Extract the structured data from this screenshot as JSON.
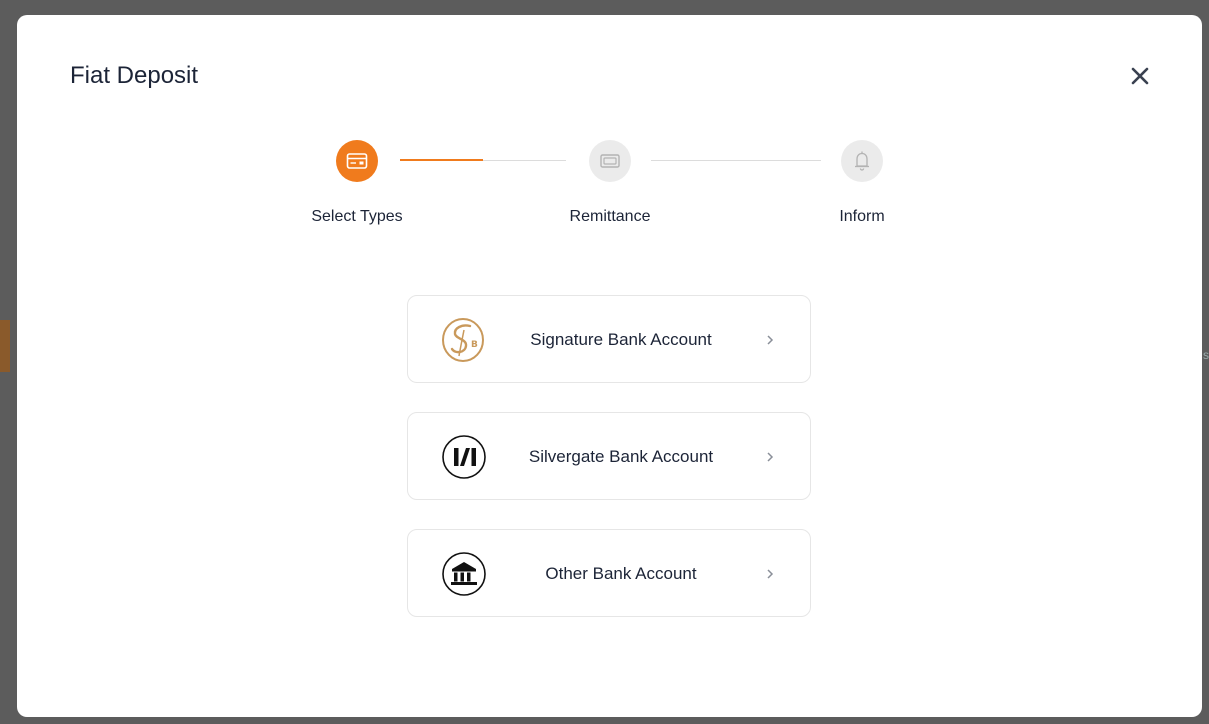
{
  "modal": {
    "title": "Fiat Deposit"
  },
  "stepper": {
    "steps": [
      {
        "label": "Select Types",
        "icon": "card-icon",
        "state": "active"
      },
      {
        "label": "Remittance",
        "icon": "wallet-icon",
        "state": "inactive"
      },
      {
        "label": "Inform",
        "icon": "bell-icon",
        "state": "inactive"
      }
    ],
    "progress_fraction_of_first_segment": 0.5
  },
  "options": [
    {
      "label": "Signature Bank Account",
      "icon": "signature-bank-logo-icon"
    },
    {
      "label": "Silvergate Bank Account",
      "icon": "silvergate-logo-icon"
    },
    {
      "label": "Other Bank Account",
      "icon": "bank-building-icon"
    }
  ],
  "colors": {
    "accent": "#f07b1d",
    "text": "#1c2437",
    "inactive_step": "#ebebeb",
    "signature_gold": "#c9995b"
  }
}
